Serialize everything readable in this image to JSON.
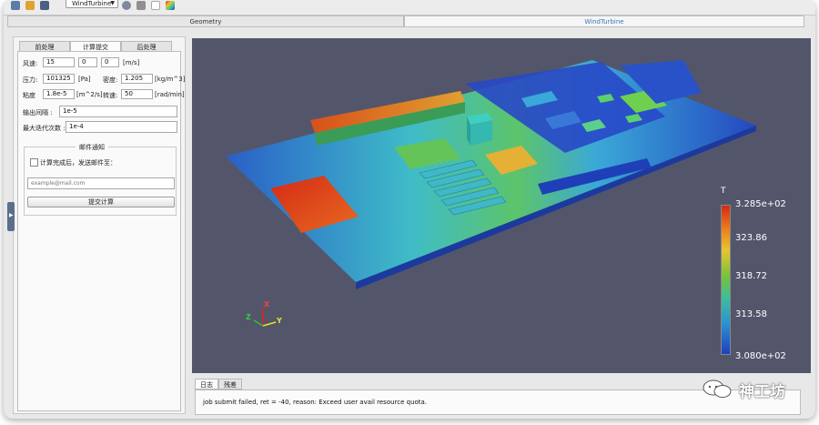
{
  "toolbar": {
    "project_combo": "WindTurbine",
    "icons": [
      "new-file-icon",
      "open-folder-icon",
      "save-icon",
      "gear-icon",
      "tools-icon",
      "document-icon",
      "colormap-icon"
    ]
  },
  "doc_tabs": [
    {
      "label": "Geometry",
      "active": false
    },
    {
      "label": "WindTurbine",
      "active": true
    }
  ],
  "side_panel": {
    "tabs": [
      {
        "label": "前处理",
        "active": false
      },
      {
        "label": "计算提交",
        "active": true
      },
      {
        "label": "后处理",
        "active": false
      }
    ],
    "wind": {
      "label": "风速:",
      "vx": "15",
      "vy": "0",
      "vz": "0",
      "unit": "[m/s]"
    },
    "pressure": {
      "label": "压力:",
      "value": "101325",
      "unit": "[Pa]"
    },
    "density": {
      "label": "密度:",
      "value": "1.205",
      "unit": "[kg/m^3]"
    },
    "viscosity": {
      "label": "粘度",
      "value": "1.8e-5",
      "unit": "[m^2/s]"
    },
    "rotation": {
      "label": "转速:",
      "value": "50",
      "unit": "[rad/min]"
    },
    "output_interval": {
      "label": "输出间隔 :",
      "value": "1e-5"
    },
    "max_iterations": {
      "label": "最大迭代次数 :",
      "value": "1e-4"
    },
    "email": {
      "group_title": "邮件通知",
      "checkbox_label": "计算完成后，发送邮件至：",
      "checked": false,
      "placeholder": "example@mail.com"
    },
    "submit_label": "提交计算"
  },
  "viewport": {
    "legend": {
      "title": "T",
      "values": [
        "3.285e+02",
        "323.86",
        "318.72",
        "313.58",
        "3.080e+02"
      ],
      "colors": {
        "max": "#d42a16",
        "mid": "#77c13b",
        "min": "#1e3fbf"
      }
    },
    "axes": {
      "x": "X",
      "y": "Y",
      "z": "Z"
    }
  },
  "log_panel": {
    "tabs": [
      {
        "label": "日志",
        "active": true
      },
      {
        "label": "残差",
        "active": false
      }
    ],
    "message": "job submit failed, ret = -40, reason: Exceed user avail resource quota."
  },
  "watermark": {
    "text": "神工坊"
  }
}
